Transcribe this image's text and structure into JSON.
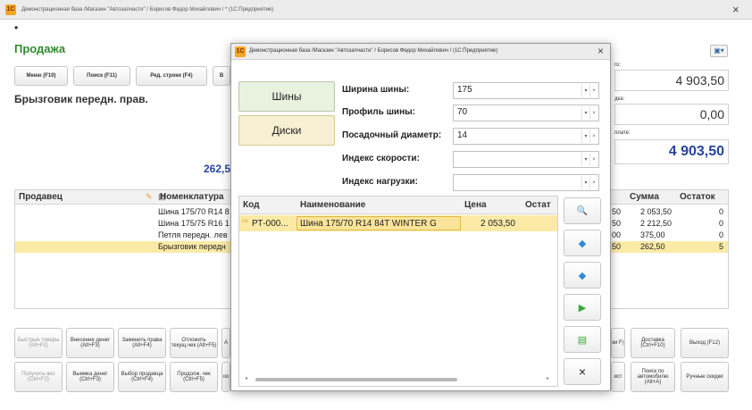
{
  "window": {
    "title": "Демонстрационная база /Магазин \"Автозапчасти\" / Борисов Федор Михайлович / * (1С:Предприятие)",
    "close": "×",
    "dot": "•"
  },
  "main": {
    "title": "Продажа",
    "toolbar": [
      "Меню (F10)",
      "Поиск (F11)",
      "Ред. строки (F4)",
      "В"
    ],
    "product_name": "Брызговик передн. прав.",
    "price_big": "262,5",
    "totals": {
      "label1": "го:",
      "value1": "4 903,50",
      "label2": "дка:",
      "value2": "0,00",
      "label3": "плате:",
      "value3": "4 903,50"
    },
    "table": {
      "headers": [
        "Продавец",
        "Номенклатура",
        "Сумма",
        "Остаток"
      ],
      "rows": [
        {
          "name": "Шина 175/70 R14 8",
          "qty": "50",
          "sum": "2 053,50",
          "rest": "0",
          "selected": false
        },
        {
          "name": "Шина 175/75 R16 1",
          "qty": "50",
          "sum": "2 212,50",
          "rest": "0",
          "selected": false
        },
        {
          "name": "Петля передн. лев",
          "qty": "00",
          "sum": "375,00",
          "rest": "0",
          "selected": false
        },
        {
          "name": "Брызговик передн",
          "qty": "50",
          "sum": "262,50",
          "rest": "5",
          "selected": true
        }
      ]
    },
    "bottom_row1": [
      "Быстрые товары (Alt+F2)",
      "Внесение денег (Alt+F3)",
      "Заменить права (Alt+F4)",
      "Отложить текущ.чек (Alt+F5)",
      "А"
    ],
    "bottom_row2": [
      "Получить вес (Ctrl+F2)",
      "Выемка денег (Ctrl+F3)",
      "Выбор продавца (Ctrl+F4)",
      "Продолж. чек (Ctrl+F5)",
      "оо"
    ],
    "bottom_right1": [
      "ки F)",
      "Доставка (Ctrl+F10)",
      "Выход (F12)"
    ],
    "bottom_right2": [
      "ист",
      "Поиск по автомобилю (Alt+A)",
      "Ручные скидки"
    ]
  },
  "dialog": {
    "title": "Демонстрационная база /Магазин \"Автозапчасти\" / Борисов Федор Михайлович / (1С:Предприятие)",
    "close": "×",
    "category_tires": "Шины",
    "category_disks": "Диски",
    "fields": [
      {
        "label": "Ширина шины:",
        "value": "175"
      },
      {
        "label": "Профиль шины:",
        "value": "70"
      },
      {
        "label": "Посадочный диаметр:",
        "value": "14"
      },
      {
        "label": "Индекс скорости:",
        "value": ""
      },
      {
        "label": "Индекс нагрузки:",
        "value": ""
      }
    ],
    "table": {
      "headers": [
        "Код",
        "Наименование",
        "Цена",
        "Остат"
      ],
      "rows": [
        {
          "code": "РТ-000...",
          "name": "Шина 175/70 R14 84T WINTER G",
          "price": "2 053,50",
          "rest": ""
        }
      ]
    },
    "side_icons": [
      "search-icon",
      "diamond-blue-icon",
      "diamond-blue-icon",
      "play-green-icon",
      "add-green-icon",
      "close-icon"
    ],
    "side_close": "×"
  }
}
